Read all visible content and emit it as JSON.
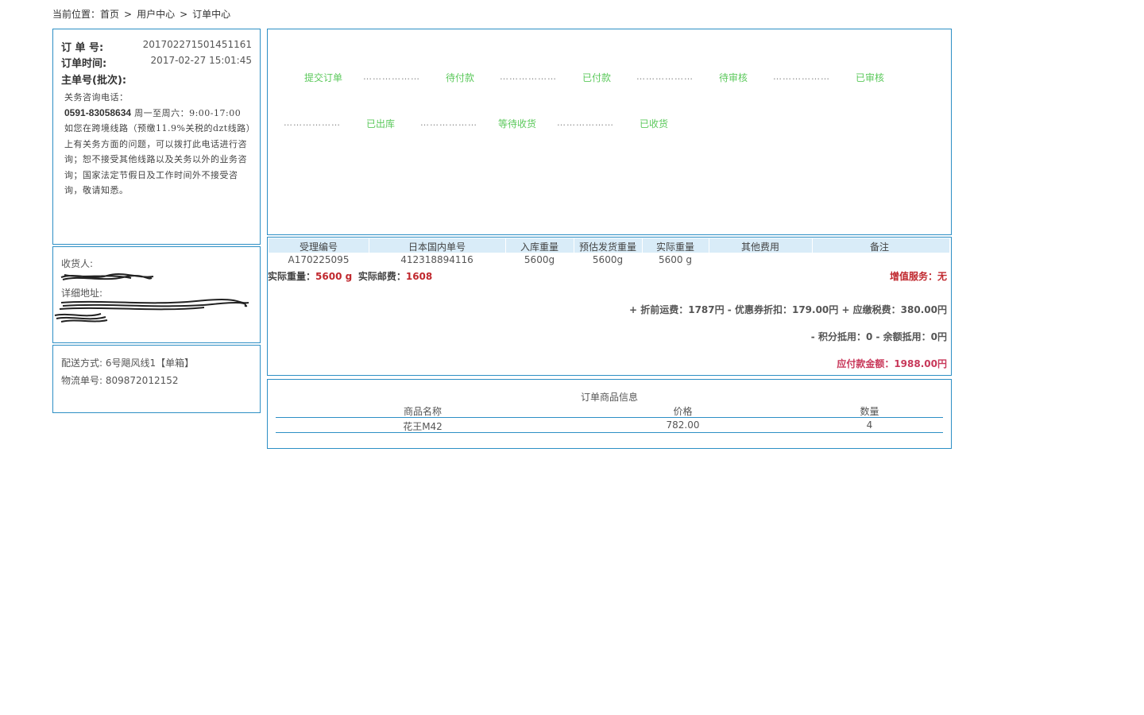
{
  "breadcrumb": {
    "prefix": "当前位置：",
    "items": [
      "首页",
      "用户中心",
      "订单中心"
    ],
    "separator": ">"
  },
  "order_info": {
    "order_no_label": "订 单 号:",
    "order_no": "201702271501451161",
    "order_time_label": "订单时间:",
    "order_time": "2017-02-27 15:01:45",
    "master_no_label": "主单号(批次):",
    "notice_title": "关务咨询电话：",
    "notice_phone": "0591-83058634",
    "notice_hours": " 周一至周六：9:00-17:00",
    "notice_body": "如您在跨境线路（预缴11.9%关税的dzt线路）上有关务方面的问题，可以拨打此电话进行咨询；恕不接受其他线路以及关务以外的业务咨询；国家法定节假日及工作时间外不接受咨询，敬请知悉。"
  },
  "recipient": {
    "name_label": "收货人:",
    "address_label": "详细地址:"
  },
  "shipping": {
    "method_label": "配送方式:",
    "method": "6号飓风线1【单箱】",
    "tracking_label": "物流单号:",
    "tracking_no": "809872012152"
  },
  "progress": {
    "row1": [
      "提交订单",
      "待付款",
      "已付款",
      "待审核",
      "已审核"
    ],
    "row2": [
      "已出库",
      "等待收货",
      "已收货"
    ],
    "dots": "………………",
    "step_color": "#5cc95c"
  },
  "package_table": {
    "headers": [
      "受理编号",
      "日本国内单号",
      "入库重量",
      "预估发货重量",
      "实际重量",
      "其他费用",
      "备注"
    ],
    "rows": [
      [
        "A170225095",
        "412318894116",
        "5600g",
        "5600g",
        "5600 g",
        "",
        ""
      ]
    ]
  },
  "summary": {
    "actual_weight_label": "实际重量：",
    "actual_weight": "5600 g",
    "actual_postage_label": "实际邮费：",
    "actual_postage": "1608",
    "value_added_label": "增值服务：",
    "value_added": "无",
    "fee_line1": "+ 折前运费：1787円 - 优惠券折扣：179.00円 + 应缴税费：380.00円",
    "fee_line2": "- 积分抵用：0 - 余额抵用：0円",
    "total_label": "应付款金额：",
    "total": "1988.00円",
    "accent_red": "#c0282e",
    "accent_pink": "#c8385a"
  },
  "goods": {
    "title": "订单商品信息",
    "headers": [
      "商品名称",
      "价格",
      "数量"
    ],
    "rows": [
      [
        "花王M42",
        "782.00",
        "4"
      ]
    ]
  },
  "colors": {
    "border": "#2d8fc5",
    "table_header_bg": "#d9ecf8"
  }
}
